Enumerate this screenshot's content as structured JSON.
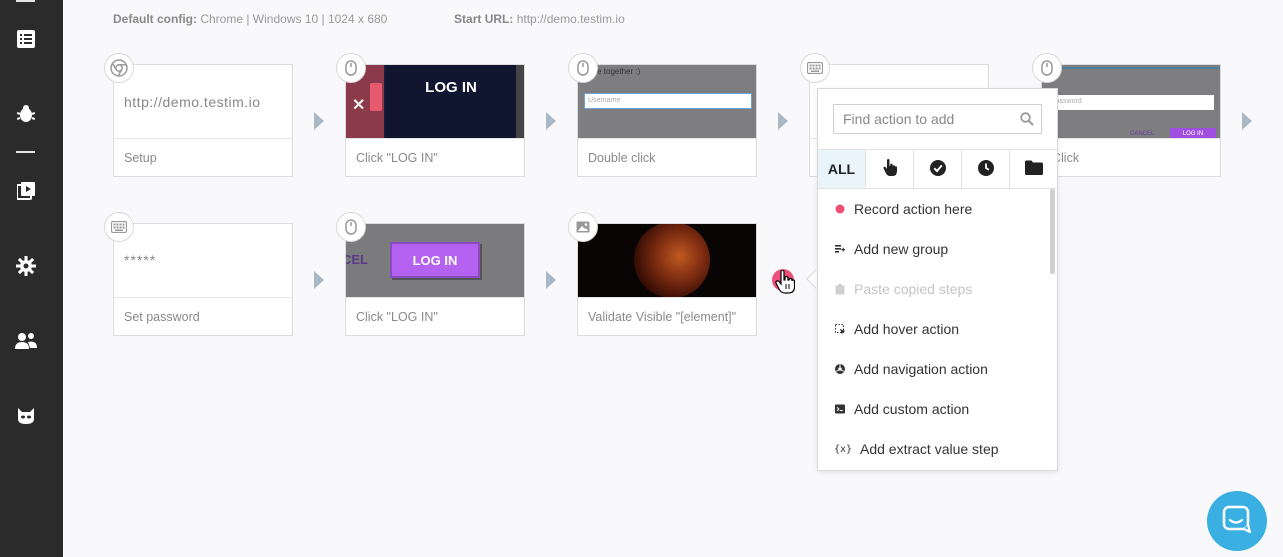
{
  "config": {
    "default_label": "Default config:",
    "default_value": "Chrome | Windows 10 | 1024 x 680",
    "start_label": "Start URL:",
    "start_value": "http://demo.testim.io"
  },
  "steps": [
    {
      "type": "browser",
      "thumb_text": "http://demo.testim.io",
      "label": "Setup"
    },
    {
      "type": "mouse",
      "thumb_text": "LOG IN",
      "label": "Click \"LOG IN\""
    },
    {
      "type": "mouse",
      "thumb_text": "verse together :)",
      "thumb_placeholder": "Username",
      "label": "Double click"
    },
    {
      "type": "keyboard",
      "label": ""
    },
    {
      "type": "mouse",
      "thumb_placeholder": "Password",
      "thumb_cancel": "CANCEL",
      "thumb_login": "LOG IN",
      "label": "Click"
    },
    {
      "type": "keyboard",
      "thumb_text": "*****",
      "label": "Set password"
    },
    {
      "type": "mouse",
      "thumb_text": "LOG IN",
      "thumb_side": "CEL",
      "label": "Click \"LOG IN\""
    },
    {
      "type": "image",
      "label": "Validate Visible \"[element]\""
    }
  ],
  "popup": {
    "search_placeholder": "Find action to add",
    "tabs": [
      {
        "label": "ALL",
        "icon": "all"
      },
      {
        "label": "",
        "icon": "hand-pointer-icon"
      },
      {
        "label": "",
        "icon": "check-circle-icon"
      },
      {
        "label": "",
        "icon": "clock-icon"
      },
      {
        "label": "",
        "icon": "folder-icon"
      }
    ],
    "items": [
      {
        "label": "Record action here",
        "icon": "record-dot-icon",
        "disabled": false
      },
      {
        "label": "Add new group",
        "icon": "add-group-icon",
        "disabled": false
      },
      {
        "label": "Paste copied steps",
        "icon": "paste-icon",
        "disabled": true
      },
      {
        "label": "Add hover action",
        "icon": "hover-icon",
        "disabled": false
      },
      {
        "label": "Add navigation action",
        "icon": "navigation-icon",
        "disabled": false
      },
      {
        "label": "Add custom action",
        "icon": "custom-action-icon",
        "disabled": false
      },
      {
        "label": "Add extract value step",
        "icon": "extract-value-icon",
        "disabled": false
      }
    ]
  },
  "colors": {
    "sidebar": "#2b2b2b",
    "record_dot": "#ee4f7a",
    "login_purple": "#b562f0",
    "chat": "#3ab0e2",
    "tab_active": "#eaf4fb"
  }
}
